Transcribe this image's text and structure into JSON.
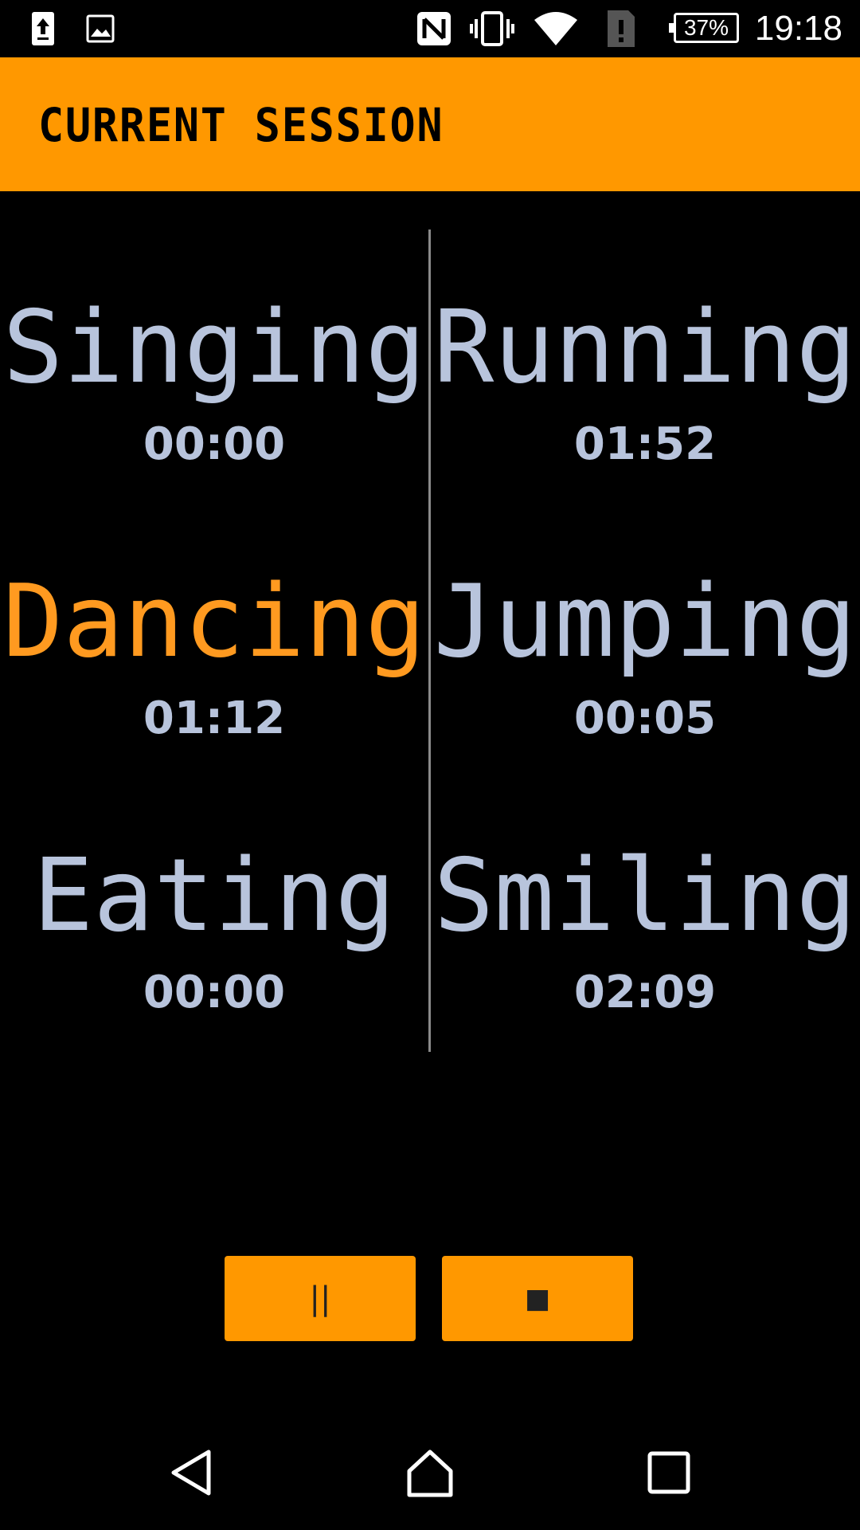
{
  "status_bar": {
    "time": "19:18",
    "battery": "37%",
    "icons": [
      "upload-icon",
      "image-icon",
      "nfc-icon",
      "vibrate-icon",
      "wifi-icon",
      "sim-alert-icon",
      "battery-icon"
    ]
  },
  "app_bar": {
    "title": "CURRENT SESSION"
  },
  "activities": [
    {
      "name": "Singing",
      "time": "00:00",
      "active": false
    },
    {
      "name": "Running",
      "time": "01:52",
      "active": false
    },
    {
      "name": "Dancing",
      "time": "01:12",
      "active": true
    },
    {
      "name": "Jumping",
      "time": "00:05",
      "active": false
    },
    {
      "name": "Eating",
      "time": "00:00",
      "active": false
    },
    {
      "name": "Smiling",
      "time": "02:09",
      "active": false
    }
  ],
  "controls": {
    "pause_label": "||",
    "stop_label": "■"
  },
  "colors": {
    "accent": "#ff9800",
    "active_text": "#ff9a20",
    "text": "#b8c4dc",
    "background": "#000000"
  },
  "nav_bar": {
    "icons": [
      "back-icon",
      "home-icon",
      "recents-icon"
    ]
  }
}
